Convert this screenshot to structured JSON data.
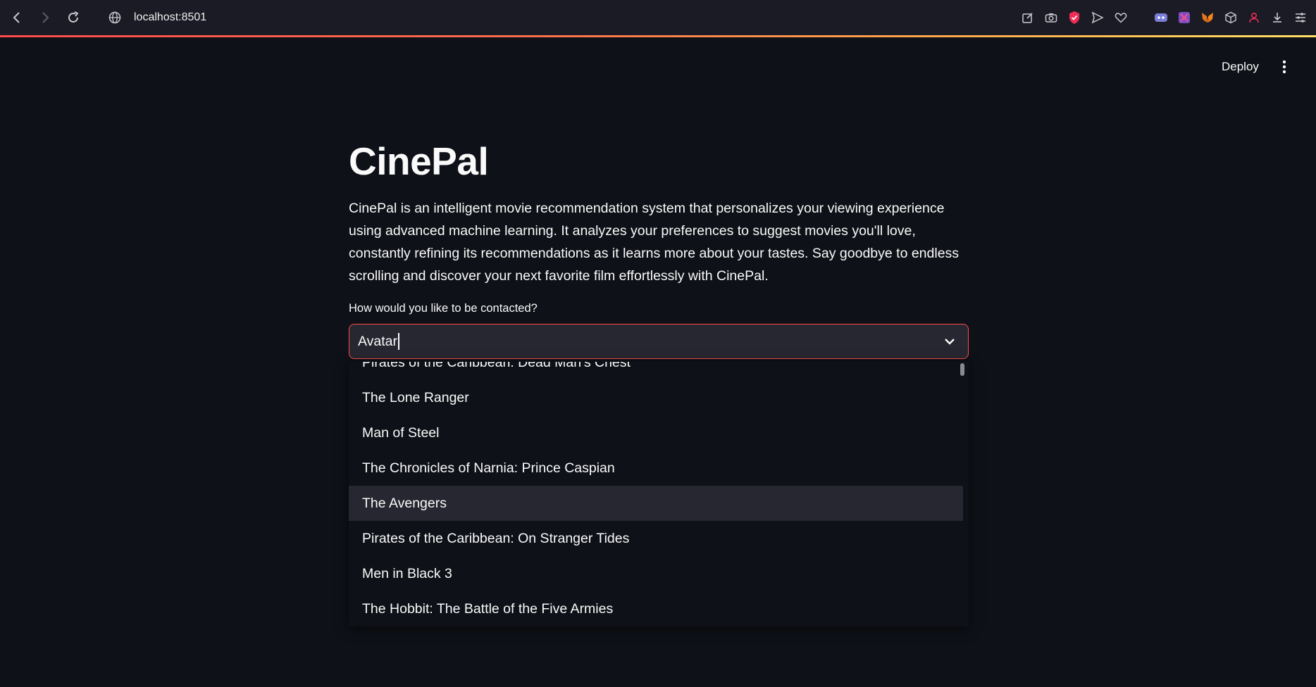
{
  "browser": {
    "url": "localhost:8501",
    "icons": [
      "edit-icon",
      "camera-icon",
      "shield-icon",
      "send-icon",
      "heart-icon",
      "discord-icon",
      "extension-icon",
      "metamask-icon",
      "cube-icon",
      "profile-icon",
      "download-icon",
      "menu-icon"
    ]
  },
  "header": {
    "deploy_label": "Deploy"
  },
  "main": {
    "title": "CinePal",
    "description": "CinePal is an intelligent movie recommendation system that personalizes your viewing experience using advanced machine learning. It analyzes your preferences to suggest movies you'll love, constantly refining its recommendations as it learns more about your tastes. Say goodbye to endless scrolling and discover your next favorite film effortlessly with CinePal.",
    "select_label": "How would you like to be contacted?",
    "select_value": "Avatar"
  },
  "dropdown": {
    "options": [
      "Pirates of the Caribbean: Dead Man's Chest",
      "The Lone Ranger",
      "Man of Steel",
      "The Chronicles of Narnia: Prince Caspian",
      "The Avengers",
      "Pirates of the Caribbean: On Stranger Tides",
      "Men in Black 3",
      "The Hobbit: The Battle of the Five Armies"
    ],
    "highlighted": "The Avengers"
  },
  "colors": {
    "background": "#0e1117",
    "accent": "#ff4b4b",
    "input_bg": "#262730"
  }
}
